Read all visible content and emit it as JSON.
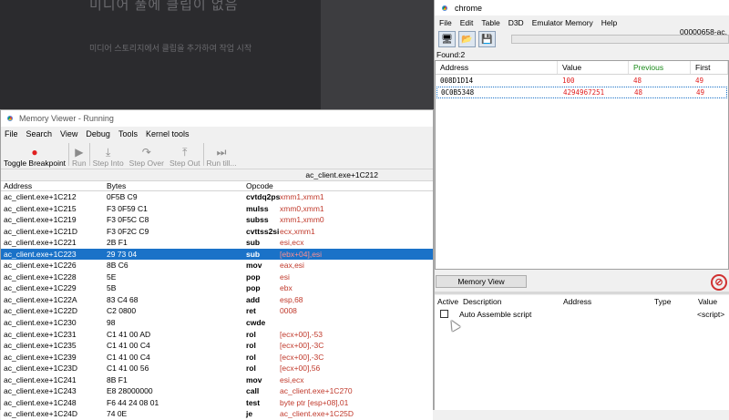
{
  "media": {
    "title": "미디어 풀에 클립이 없음",
    "subtitle": "미디어 스토리지에서 클립을 추가하여 작업 시작"
  },
  "memory_viewer": {
    "title": "Memory Viewer - Running",
    "menu": [
      "File",
      "Search",
      "View",
      "Debug",
      "Tools",
      "Kernel tools"
    ],
    "toolbar": {
      "toggle_breakpoint": "Toggle Breakpoint",
      "run": "Run",
      "step_into": "Step Into",
      "step_over": "Step Over",
      "step_out": "Step Out",
      "run_till": "Run till..."
    },
    "location": "ac_client.exe+1C212",
    "columns": {
      "address": "Address",
      "bytes": "Bytes",
      "opcode": "Opcode"
    },
    "rows": [
      {
        "address": "ac_client.exe+1C212",
        "bytes": "0F5B C9",
        "op": "cvtdq2ps",
        "arg": "xmm1,xmm1"
      },
      {
        "address": "ac_client.exe+1C215",
        "bytes": "F3 0F59 C1",
        "op": "mulss",
        "arg": "xmm0,xmm1"
      },
      {
        "address": "ac_client.exe+1C219",
        "bytes": "F3 0F5C C8",
        "op": "subss",
        "arg": "xmm1,xmm0"
      },
      {
        "address": "ac_client.exe+1C21D",
        "bytes": "F3 0F2C C9",
        "op": "cvttss2si",
        "arg": "ecx,xmm1"
      },
      {
        "address": "ac_client.exe+1C221",
        "bytes": "2B F1",
        "op": "sub",
        "arg": "esi,ecx"
      },
      {
        "address": "ac_client.exe+1C223",
        "bytes": "29 73 04",
        "op": "sub",
        "arg": "[ebx+04],esi"
      },
      {
        "address": "ac_client.exe+1C226",
        "bytes": "8B C6",
        "op": "mov",
        "arg": "eax,esi"
      },
      {
        "address": "ac_client.exe+1C228",
        "bytes": "5E",
        "op": "pop",
        "arg": "esi"
      },
      {
        "address": "ac_client.exe+1C229",
        "bytes": "5B",
        "op": "pop",
        "arg": "ebx"
      },
      {
        "address": "ac_client.exe+1C22A",
        "bytes": "83 C4 68",
        "op": "add",
        "arg": "esp,68"
      },
      {
        "address": "ac_client.exe+1C22D",
        "bytes": "C2 0800",
        "op": "ret",
        "arg": "0008"
      },
      {
        "address": "ac_client.exe+1C230",
        "bytes": "98",
        "op": "cwde",
        "arg": ""
      },
      {
        "address": "ac_client.exe+1C231",
        "bytes": "C1 41 00 AD",
        "op": "rol",
        "arg": "[ecx+00],-53"
      },
      {
        "address": "ac_client.exe+1C235",
        "bytes": "C1 41 00 C4",
        "op": "rol",
        "arg": "[ecx+00],-3C"
      },
      {
        "address": "ac_client.exe+1C239",
        "bytes": "C1 41 00 C4",
        "op": "rol",
        "arg": "[ecx+00],-3C"
      },
      {
        "address": "ac_client.exe+1C23D",
        "bytes": "C1 41 00 56",
        "op": "rol",
        "arg": "[ecx+00],56"
      },
      {
        "address": "ac_client.exe+1C241",
        "bytes": "8B F1",
        "op": "mov",
        "arg": "esi,ecx"
      },
      {
        "address": "ac_client.exe+1C243",
        "bytes": "E8 28000000",
        "op": "call",
        "arg": "ac_client.exe+1C270"
      },
      {
        "address": "ac_client.exe+1C248",
        "bytes": "F6 44 24 08 01",
        "op": "test",
        "arg": "byte ptr [esp+08],01"
      },
      {
        "address": "ac_client.exe+1C24D",
        "bytes": "74 0E",
        "op": "je",
        "arg": "ac_client.exe+1C25D"
      }
    ]
  },
  "cheat_engine": {
    "title": "chrome",
    "menu": [
      "File",
      "Edit",
      "Table",
      "D3D",
      "Emulator Memory",
      "Help"
    ],
    "process": "00000658-ac.",
    "found": "Found:2",
    "columns": {
      "address": "Address",
      "value": "Value",
      "previous": "Previous",
      "first": "First"
    },
    "results": [
      {
        "address": "008D1D14",
        "value": "100",
        "previous": "48",
        "first": "49"
      },
      {
        "address": "0C0B5348",
        "value": "4294967251",
        "previous": "48",
        "first": "49"
      }
    ],
    "memory_view_button": "Memory View",
    "table_columns": {
      "active": "Active",
      "description": "Description",
      "address": "Address",
      "type": "Type",
      "value": "Value"
    },
    "table_rows": [
      {
        "description": "Auto Assemble script",
        "address": "",
        "type": "",
        "value": "<script>"
      }
    ]
  }
}
